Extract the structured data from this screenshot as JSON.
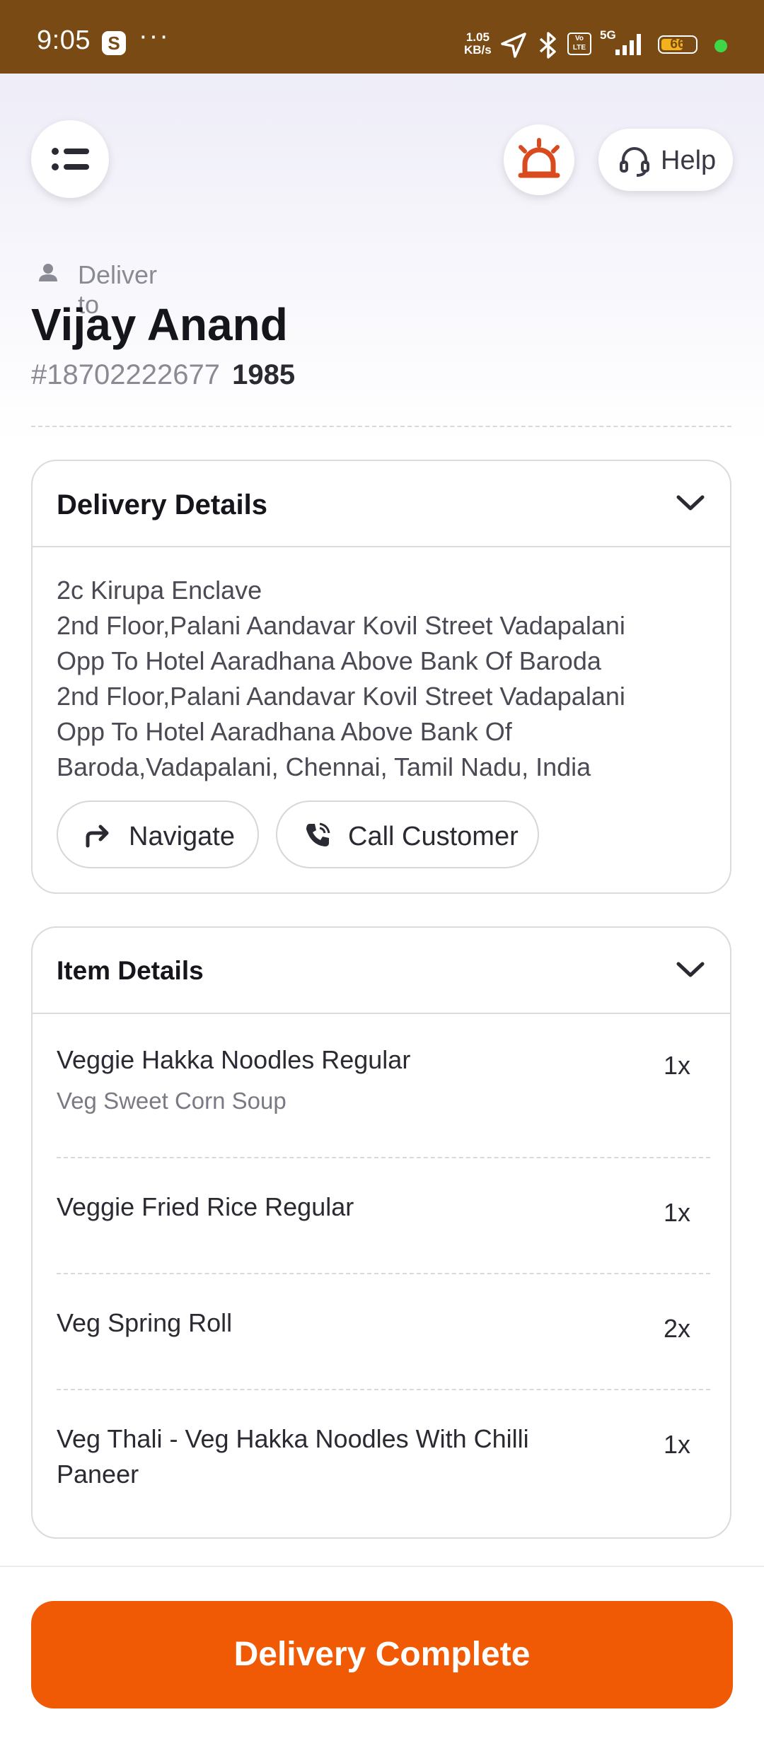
{
  "status_bar": {
    "time": "9:05",
    "app_badge": "S",
    "overflow": "···",
    "net_speed_value": "1.05",
    "net_speed_unit": "KB/s",
    "network": "5G",
    "volte": "Vo LTE",
    "battery": "66",
    "battery_level": 0.66,
    "colors": {
      "background": "#7a4a14",
      "battery": "#f3b21c",
      "dot": "#3fd64a"
    }
  },
  "header": {
    "menu_icon": "list-menu-icon",
    "alert_icon": "siren-icon",
    "help_icon": "headset-icon",
    "help_label": "Help",
    "deliver_to_label": "Deliver to",
    "customer_name": "Vijay Anand",
    "order_id": "#18702222677",
    "order_code": "1985"
  },
  "delivery_details": {
    "title": "Delivery Details",
    "address_lines": [
      "2c Kirupa Enclave",
      "2nd Floor,Palani Aandavar Kovil Street Vadapalani",
      "Opp To Hotel Aaradhana Above Bank Of Baroda",
      "2nd Floor,Palani Aandavar Kovil Street Vadapalani",
      "Opp To Hotel Aaradhana Above Bank Of",
      "Baroda,Vadapalani, Chennai, Tamil Nadu, India"
    ],
    "navigate_label": "Navigate",
    "call_label": "Call Customer"
  },
  "item_details": {
    "title": "Item Details",
    "items": [
      {
        "name": "Veggie Hakka Noodles Regular",
        "sub": "Veg Sweet Corn Soup",
        "qty": "1x"
      },
      {
        "name": "Veggie Fried Rice Regular",
        "qty": "1x"
      },
      {
        "name": "Veg Spring Roll",
        "qty": "2x"
      },
      {
        "name": "Veg Thali - Veg Hakka Noodles With Chilli Paneer",
        "qty": "1x"
      }
    ]
  },
  "footer": {
    "complete_label": "Delivery Complete",
    "accent_color": "#f05a05"
  }
}
